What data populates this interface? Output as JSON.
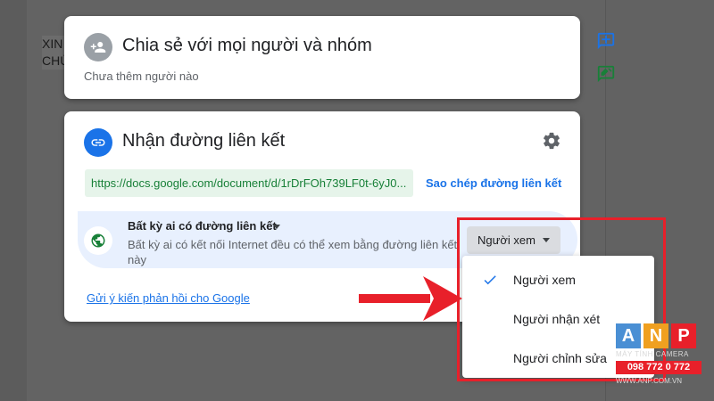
{
  "document": {
    "text_line_1": "XIN",
    "text_line_2": "CHÚ"
  },
  "share_people": {
    "icon": "person-add-icon",
    "title": "Chia sẻ với mọi người và nhóm",
    "subtitle": "Chưa thêm người nào"
  },
  "get_link": {
    "icon": "link-icon",
    "title": "Nhận đường liên kết",
    "settings_icon": "gear-icon",
    "link_url": "https://docs.google.com/document/d/1rDrFOh739LF0t-6yJ0...",
    "copy_label": "Sao chép đường liên kết",
    "access": {
      "icon": "globe-icon",
      "title": "Bất kỳ ai có đường liên kết",
      "description": "Bất kỳ ai có kết nối Internet đều có thể xem bằng đường liên kết này"
    },
    "role_selected": "Người xem",
    "feedback_label": "Gửi ý kiến phản hồi cho Google"
  },
  "role_menu": {
    "items": [
      {
        "label": "Người xem",
        "selected": true
      },
      {
        "label": "Người nhận xét",
        "selected": false
      },
      {
        "label": "Người chỉnh sửa",
        "selected": false
      }
    ]
  },
  "watermark": {
    "letters": [
      "A",
      "N",
      "P"
    ],
    "tagline": "MÁY TÍNH CAMERA",
    "phone": "098 772 0 772",
    "site": "WWW.ANP.COM.VN"
  },
  "colors": {
    "accent_blue": "#1a73e8",
    "link_green": "#188038",
    "highlight_red": "#e8202a",
    "globe_green": "#188038"
  }
}
